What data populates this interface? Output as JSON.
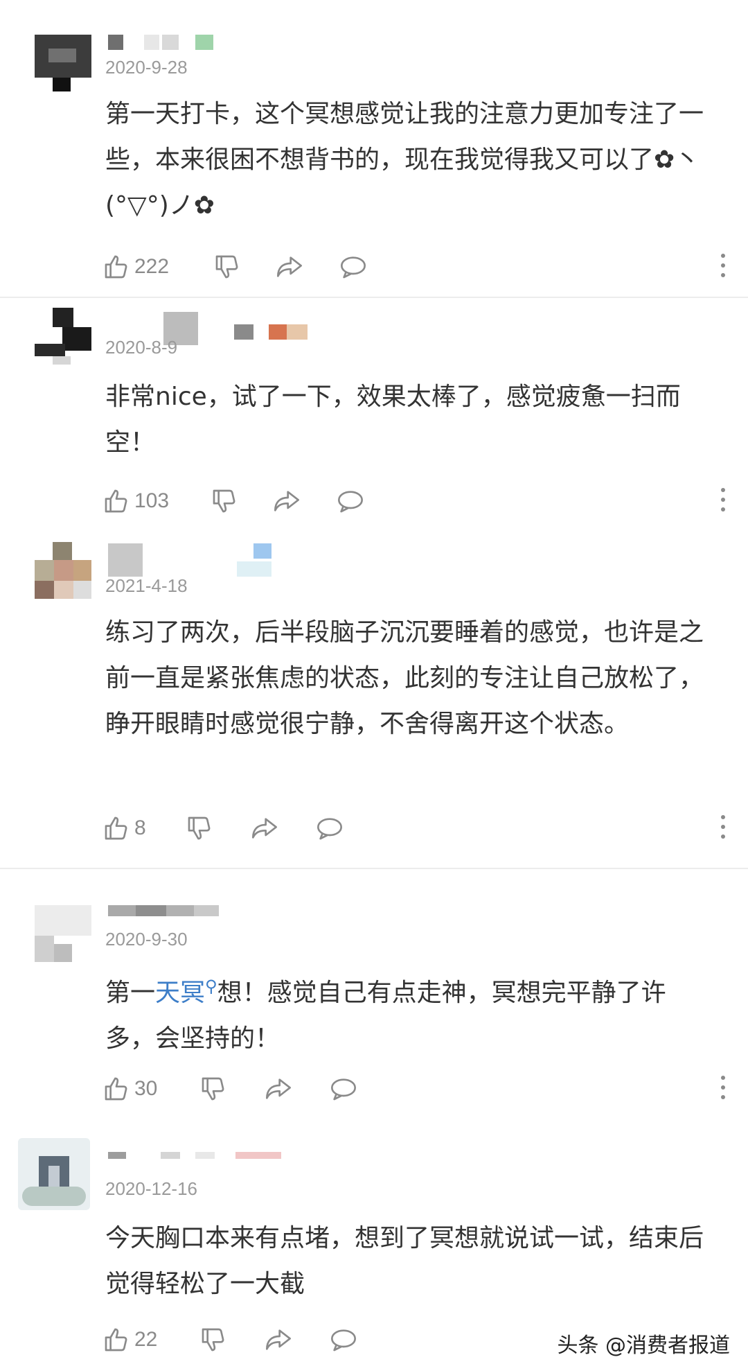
{
  "comments": [
    {
      "date": "2020-9-28",
      "text": "第一天打卡，这个冥想感觉让我的注意力更加专注了一些，本来很困不想背书的，现在我觉得我又可以了✿丶(°▽°)ノ✿",
      "likes": "222"
    },
    {
      "date": "2020-8-9",
      "text": "非常nice，试了一下，效果太棒了，感觉疲惫一扫而空！",
      "likes": "103"
    },
    {
      "date": "2021-4-18",
      "text": "练习了两次，后半段脑子沉沉要睡着的感觉，也许是之前一直是紧张焦虑的状态，此刻的专注让自己放松了，睁开眼睛时感觉很宁静，不舍得离开这个状态。",
      "likes": "8"
    },
    {
      "date": "2020-9-30",
      "text_before": "第一",
      "text_link": "天冥",
      "text_after": "想！感觉自己有点走神，冥想完平静了许多，会坚持的！",
      "likes": "30"
    },
    {
      "date": "2020-12-16",
      "text": "今天胸口本来有点堵，想到了冥想就说试一试，结束后觉得轻松了一大截",
      "likes": "22"
    }
  ],
  "watermark": "头条 @消费者报道",
  "icons": {
    "like": "thumbs-up-icon",
    "dislike": "thumbs-down-icon",
    "share": "share-arrow-icon",
    "reply": "speech-bubble-icon",
    "more": "more-vertical-icon",
    "search": "search-icon"
  },
  "colors": {
    "text": "#333333",
    "meta": "#9a9a9a",
    "link": "#3d7ec8"
  }
}
